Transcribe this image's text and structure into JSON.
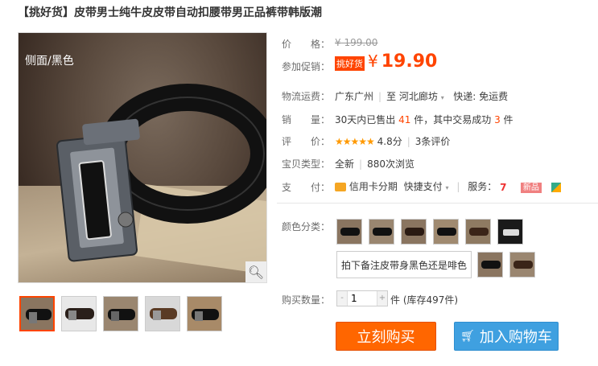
{
  "product": {
    "title": "【挑好货】皮带男士纯牛皮皮带自动扣腰带男正品裤带韩版潮",
    "image_caption": "侧面/黑色"
  },
  "price": {
    "label": "价　　格：",
    "original": "¥ 199.00"
  },
  "promo": {
    "label": "参加促销：",
    "tag": "挑好货",
    "currency": "¥",
    "price": "19.90"
  },
  "shipping": {
    "label": "物流运费：",
    "from": "广东广州",
    "to_prefix": "至",
    "to": "河北廊坊",
    "method": "快递: 免运费"
  },
  "sales": {
    "label": "销　　量：",
    "prefix": "30天内已售出",
    "count": "41",
    "mid": "件，其中交易成功",
    "success": "3",
    "suffix": "件"
  },
  "rating": {
    "label": "评　　价：",
    "stars": "★★★★★",
    "score": "4.8分",
    "reviews": "3条评价"
  },
  "type": {
    "label": "宝贝类型：",
    "condition": "全新",
    "views": "880次浏览"
  },
  "payment": {
    "label": "支　　付：",
    "credit": "信用卡分期",
    "quick": "快捷支付",
    "service_label": "服务：",
    "new_badge": "新品"
  },
  "color": {
    "label": "颜色分类：",
    "note": "拍下备注皮带身黑色还是啡色"
  },
  "quantity": {
    "label": "购买数量：",
    "value": "1",
    "unit": "件",
    "stock": "(库存497件)"
  },
  "actions": {
    "buy": "立刻购买",
    "cart": "加入购物车"
  },
  "colors": {
    "accent": "#ff4400",
    "buy_button": "#ff6600",
    "cart_button": "#3fa0e0"
  }
}
